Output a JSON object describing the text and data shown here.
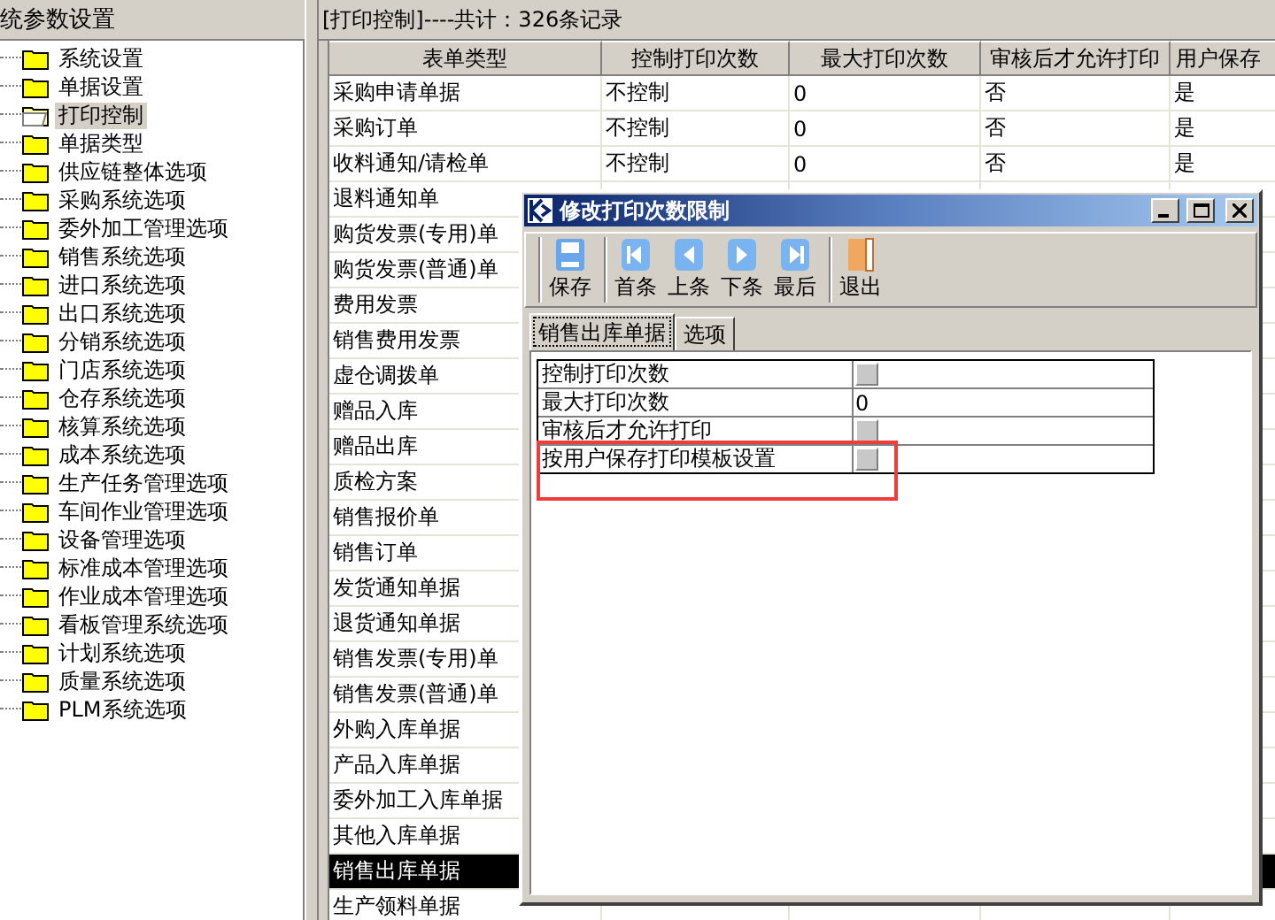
{
  "sidebar": {
    "title": "统参数设置",
    "items": [
      {
        "label": "系统设置",
        "selected": false
      },
      {
        "label": "单据设置",
        "selected": false
      },
      {
        "label": "打印控制",
        "selected": true
      },
      {
        "label": "单据类型",
        "selected": false
      },
      {
        "label": "供应链整体选项",
        "selected": false
      },
      {
        "label": "采购系统选项",
        "selected": false
      },
      {
        "label": "委外加工管理选项",
        "selected": false
      },
      {
        "label": "销售系统选项",
        "selected": false
      },
      {
        "label": "进口系统选项",
        "selected": false
      },
      {
        "label": "出口系统选项",
        "selected": false
      },
      {
        "label": "分销系统选项",
        "selected": false
      },
      {
        "label": "门店系统选项",
        "selected": false
      },
      {
        "label": "仓存系统选项",
        "selected": false
      },
      {
        "label": "核算系统选项",
        "selected": false
      },
      {
        "label": "成本系统选项",
        "selected": false
      },
      {
        "label": "生产任务管理选项",
        "selected": false
      },
      {
        "label": "车间作业管理选项",
        "selected": false
      },
      {
        "label": "设备管理选项",
        "selected": false
      },
      {
        "label": "标准成本管理选项",
        "selected": false
      },
      {
        "label": "作业成本管理选项",
        "selected": false
      },
      {
        "label": "看板管理系统选项",
        "selected": false
      },
      {
        "label": "计划系统选项",
        "selected": false
      },
      {
        "label": "质量系统选项",
        "selected": false
      },
      {
        "label": "PLM系统选项",
        "selected": false
      }
    ]
  },
  "list": {
    "title": "[打印控制]----共计：326条记录",
    "columns": [
      "表单类型",
      "控制打印次数",
      "最大打印次数",
      "审核后才允许打印",
      "用户保存"
    ],
    "rows": [
      {
        "cells": [
          "采购申请单据",
          "不控制",
          "0",
          "否",
          "是"
        ],
        "selected": false
      },
      {
        "cells": [
          "采购订单",
          "不控制",
          "0",
          "否",
          "是"
        ],
        "selected": false
      },
      {
        "cells": [
          "收料通知/请检单",
          "不控制",
          "0",
          "否",
          "是"
        ],
        "selected": false
      },
      {
        "cells": [
          "退料通知单"
        ],
        "selected": false
      },
      {
        "cells": [
          "购货发票(专用)单"
        ],
        "selected": false
      },
      {
        "cells": [
          "购货发票(普通)单"
        ],
        "selected": false
      },
      {
        "cells": [
          "费用发票"
        ],
        "selected": false
      },
      {
        "cells": [
          "销售费用发票"
        ],
        "selected": false
      },
      {
        "cells": [
          "虚仓调拨单"
        ],
        "selected": false
      },
      {
        "cells": [
          "赠品入库"
        ],
        "selected": false
      },
      {
        "cells": [
          "赠品出库"
        ],
        "selected": false
      },
      {
        "cells": [
          "质检方案"
        ],
        "selected": false
      },
      {
        "cells": [
          "销售报价单"
        ],
        "selected": false
      },
      {
        "cells": [
          "销售订单"
        ],
        "selected": false
      },
      {
        "cells": [
          "发货通知单据"
        ],
        "selected": false
      },
      {
        "cells": [
          "退货通知单据"
        ],
        "selected": false
      },
      {
        "cells": [
          "销售发票(专用)单"
        ],
        "selected": false
      },
      {
        "cells": [
          "销售发票(普通)单"
        ],
        "selected": false
      },
      {
        "cells": [
          "外购入库单据"
        ],
        "selected": false
      },
      {
        "cells": [
          "产品入库单据"
        ],
        "selected": false
      },
      {
        "cells": [
          "委外加工入库单据"
        ],
        "selected": false
      },
      {
        "cells": [
          "其他入库单据"
        ],
        "selected": false
      },
      {
        "cells": [
          "销售出库单据"
        ],
        "selected": true
      },
      {
        "cells": [
          "生产领料单据"
        ],
        "selected": false
      }
    ]
  },
  "dialog": {
    "title": "修改打印次数限制",
    "toolbar": [
      {
        "label": "保存",
        "kind": "save"
      },
      {
        "label": "首条",
        "kind": "first"
      },
      {
        "label": "上条",
        "kind": "prev"
      },
      {
        "label": "下条",
        "kind": "next"
      },
      {
        "label": "最后",
        "kind": "last"
      },
      {
        "label": "退出",
        "kind": "exit"
      }
    ],
    "tabs": [
      {
        "label": "销售出库单据",
        "selected": true
      },
      {
        "label": "选项",
        "selected": false
      }
    ],
    "properties": [
      {
        "label": "控制打印次数",
        "kind": "checkbox",
        "checked": false,
        "highlighted": false
      },
      {
        "label": "最大打印次数",
        "kind": "text",
        "value": "0",
        "highlighted": false
      },
      {
        "label": "审核后才允许打印",
        "kind": "checkbox",
        "checked": false,
        "highlighted": false
      },
      {
        "label": "按用户保存打印模板设置",
        "kind": "checkbox",
        "checked": false,
        "highlighted": true
      }
    ]
  }
}
